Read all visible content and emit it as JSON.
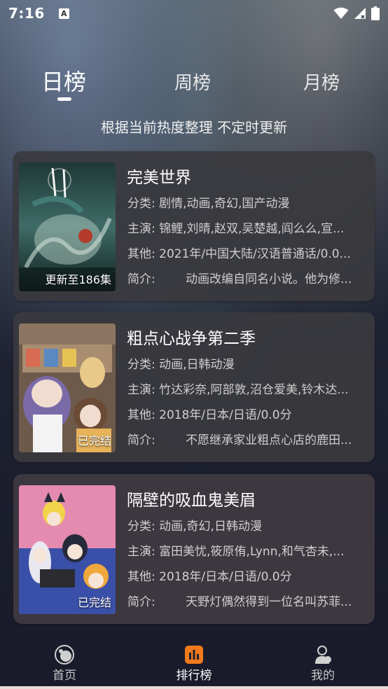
{
  "status_bar": {
    "time": "7:16",
    "notification_icon_letter": "A"
  },
  "tabs": [
    {
      "label": "日榜",
      "active": true
    },
    {
      "label": "周榜",
      "active": false
    },
    {
      "label": "月榜",
      "active": false
    }
  ],
  "subtitle": "根据当前热度整理 不定时更新",
  "labels": {
    "category": "分类:",
    "cast": "主演:",
    "other": "其他:",
    "intro": "简介:"
  },
  "items": [
    {
      "title": "完美世界",
      "badge": "更新至186集",
      "category": "剧情,动画,奇幻,国产动漫",
      "cast": "锦鲤,刘晴,赵双,吴楚越,阎么么,宣...",
      "other": "2021年/中国大陆/汉语普通话/0.0...",
      "intro": "动画改编自同名小说。他为修...",
      "poster_colors": [
        "#0e1f1c",
        "#2d5a58",
        "#9fb9ae",
        "#b43a2a"
      ]
    },
    {
      "title": "粗点心战争第二季",
      "badge": "已完结",
      "category": "动画,日韩动漫",
      "cast": "竹达彩奈,阿部敦,沼仓爱美,铃木达...",
      "other": "2018年/日本/日语/0.0分",
      "intro": "不愿继承家业粗点心店的鹿田...",
      "poster_colors": [
        "#6d5a4a",
        "#b89a7a",
        "#7a6aa8",
        "#e8d7c6"
      ]
    },
    {
      "title": "隔壁的吸血鬼美眉",
      "badge": "已完结",
      "category": "动画,奇幻,日韩动漫",
      "cast": "富田美忧,筱原侑,Lynn,和气杏未,...",
      "other": "2018年/日本/日语/0.0分",
      "intro": "天野灯偶然得到一位名叫苏菲...",
      "poster_colors": [
        "#e58bb0",
        "#3a4fa8",
        "#f3d34a",
        "#262a3a"
      ]
    }
  ],
  "nav": [
    {
      "label": "首页",
      "icon": "home-icon",
      "active": false
    },
    {
      "label": "排行榜",
      "icon": "ranking-icon",
      "active": true
    },
    {
      "label": "我的",
      "icon": "profile-icon",
      "active": false
    }
  ],
  "colors": {
    "accent": "#f07a1c",
    "card_bg": "#3a3a3e",
    "background": "#191c28"
  }
}
